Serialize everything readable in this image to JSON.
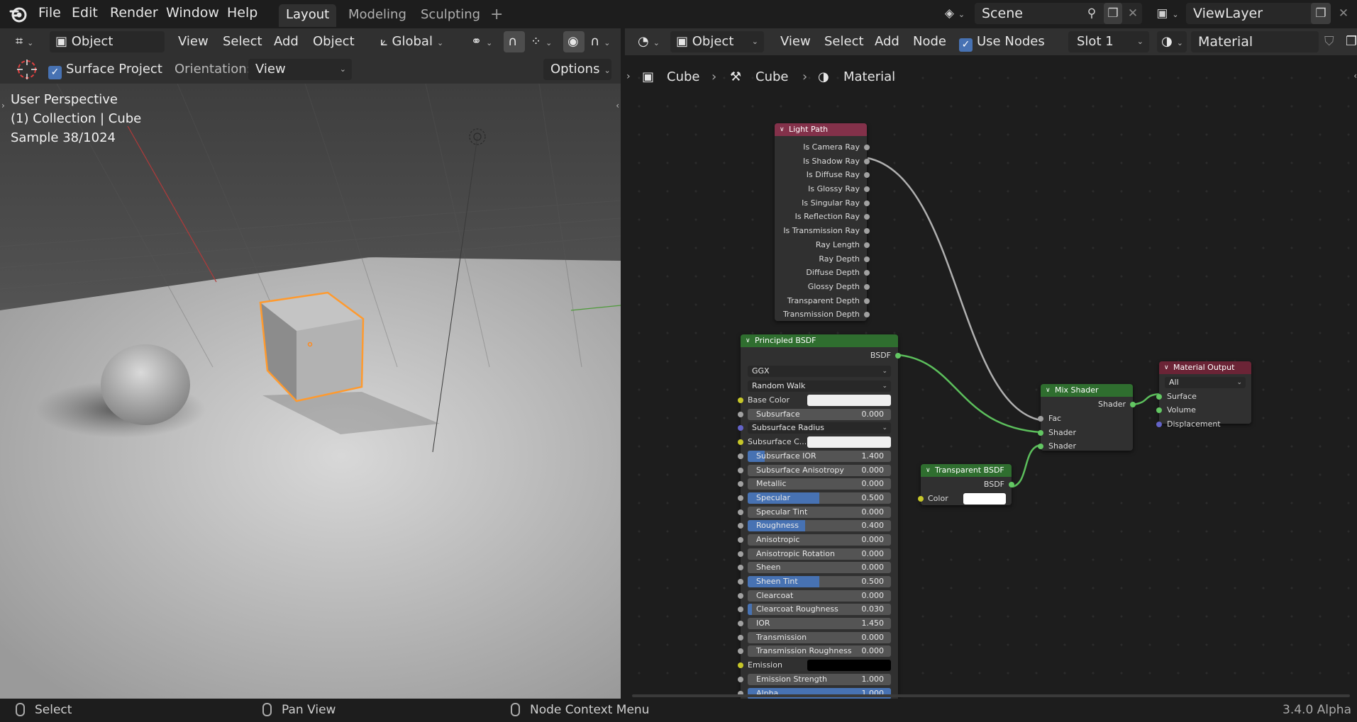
{
  "topbar": {
    "menu": [
      "File",
      "Edit",
      "Render",
      "Window",
      "Help"
    ],
    "workspaces": [
      "Layout",
      "Modeling",
      "Sculpting"
    ],
    "active_workspace": "Layout",
    "add_workspace": "+",
    "scene": "Scene",
    "view_layer": "ViewLayer"
  },
  "viewport_header": {
    "mode": "Object Mode",
    "menus": [
      "View",
      "Select",
      "Add",
      "Object"
    ],
    "transform_orientation": "Global"
  },
  "tool_settings": {
    "surface_project_label": "Surface Project",
    "surface_project_checked": true,
    "orientation_label": "Orientation:",
    "orientation_value": "View",
    "options_label": "Options"
  },
  "viewport": {
    "perspective": "User Perspective",
    "collection": "(1) Collection | Cube",
    "sample": "Sample 38/1024"
  },
  "node_header": {
    "editor_type": "Object",
    "menus": [
      "View",
      "Select",
      "Add",
      "Node"
    ],
    "use_nodes_label": "Use Nodes",
    "use_nodes_checked": true,
    "slot": "Slot 1",
    "material": "Material"
  },
  "breadcrumb": [
    "Cube",
    "Cube",
    "Material"
  ],
  "nodes": {
    "light_path": {
      "title": "Light Path",
      "outputs": [
        "Is Camera Ray",
        "Is Shadow Ray",
        "Is Diffuse Ray",
        "Is Glossy Ray",
        "Is Singular Ray",
        "Is Reflection Ray",
        "Is Transmission Ray",
        "Ray Length",
        "Ray Depth",
        "Diffuse Depth",
        "Glossy Depth",
        "Transparent Depth",
        "Transmission Depth"
      ]
    },
    "principled": {
      "title": "Principled BSDF",
      "output": "BSDF",
      "distribution": "GGX",
      "subsurface_method": "Random Walk",
      "base_color_label": "Base Color",
      "subsurface_radius_label": "Subsurface Radius",
      "subsurface_color_label": "Subsurface C...",
      "emission_label": "Emission",
      "sliders": [
        {
          "label": "Subsurface",
          "value": "0.000",
          "fill": 0
        },
        {
          "label": "Subsurface IOR",
          "value": "1.400",
          "fill": 0.12
        },
        {
          "label": "Subsurface Anisotropy",
          "value": "0.000",
          "fill": 0
        },
        {
          "label": "Metallic",
          "value": "0.000",
          "fill": 0
        },
        {
          "label": "Specular",
          "value": "0.500",
          "fill": 0.5
        },
        {
          "label": "Specular Tint",
          "value": "0.000",
          "fill": 0
        },
        {
          "label": "Roughness",
          "value": "0.400",
          "fill": 0.4
        },
        {
          "label": "Anisotropic",
          "value": "0.000",
          "fill": 0
        },
        {
          "label": "Anisotropic Rotation",
          "value": "0.000",
          "fill": 0
        },
        {
          "label": "Sheen",
          "value": "0.000",
          "fill": 0
        },
        {
          "label": "Sheen Tint",
          "value": "0.500",
          "fill": 0.5
        },
        {
          "label": "Clearcoat",
          "value": "0.000",
          "fill": 0
        },
        {
          "label": "Clearcoat Roughness",
          "value": "0.030",
          "fill": 0.03
        },
        {
          "label": "IOR",
          "value": "1.450",
          "fill": 0
        },
        {
          "label": "Transmission",
          "value": "0.000",
          "fill": 0
        },
        {
          "label": "Transmission Roughness",
          "value": "0.000",
          "fill": 0
        }
      ],
      "emission_strength": {
        "label": "Emission Strength",
        "value": "1.000",
        "fill": 0
      },
      "alpha": {
        "label": "Alpha",
        "value": "1.000",
        "fill": 1
      }
    },
    "transparent": {
      "title": "Transparent BSDF",
      "output": "BSDF",
      "color_label": "Color"
    },
    "mix_shader": {
      "title": "Mix Shader",
      "output": "Shader",
      "inputs": [
        "Fac",
        "Shader",
        "Shader"
      ]
    },
    "material_output": {
      "title": "Material Output",
      "target": "All",
      "inputs": [
        "Surface",
        "Volume",
        "Displacement"
      ]
    }
  },
  "statusbar": {
    "left": "Select",
    "middle": "Pan View",
    "right": "Node Context Menu",
    "version": "3.4.0 Alpha"
  },
  "colors": {
    "accent": "#4772b3",
    "selection_outline": "#ff9a2e",
    "shader_header": "#2f6e2f",
    "input_header": "#83314a",
    "output_header": "#6b2436"
  }
}
